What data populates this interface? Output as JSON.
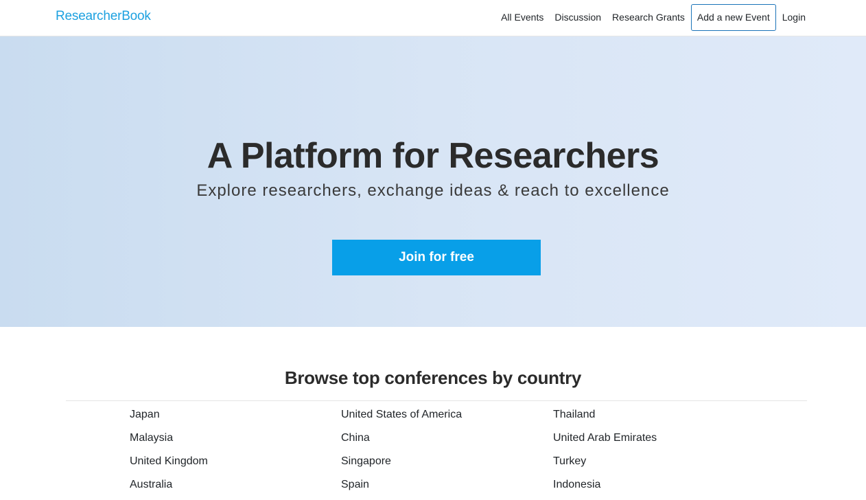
{
  "navbar": {
    "brand": "ResearcherBook",
    "links": {
      "all_events": "All Events",
      "discussion": "Discussion",
      "research_grants": "Research Grants",
      "add_event": "Add a new Event",
      "login": "Login"
    }
  },
  "hero": {
    "title": "A Platform for Researchers",
    "subtitle": "Explore researchers, exchange ideas & reach to excellence",
    "cta_label": "Join for free"
  },
  "countries_section": {
    "title": "Browse top conferences by country",
    "countries": [
      "Japan",
      "United States of America",
      "Thailand",
      "Malaysia",
      "China",
      "United Arab Emirates",
      "United Kingdom",
      "Singapore",
      "Turkey",
      "Australia",
      "Spain",
      "Indonesia"
    ]
  },
  "colors": {
    "brand": "#1da1e0",
    "cta": "#089fe8",
    "outline_button_border": "#1a73b8"
  }
}
